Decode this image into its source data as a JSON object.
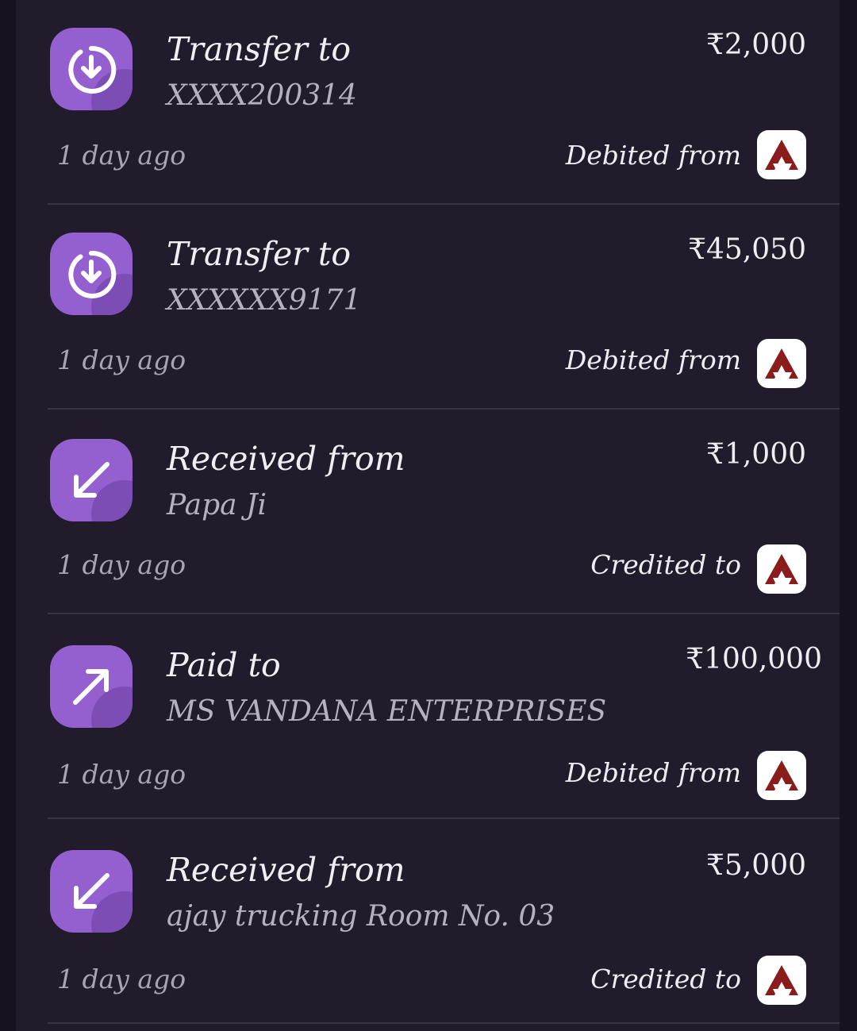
{
  "colors": {
    "background": "#17121f",
    "panel": "#221b2c",
    "icon_accent": "#9460cf",
    "bank_logo": "#8a1c1c"
  },
  "transactions": [
    {
      "type_label": "Transfer to",
      "party": "XXXX200314",
      "amount": "₹2,000",
      "time": "1 day ago",
      "direction_label": "Debited from",
      "icon": "transfer-icon",
      "bank_icon": "bank-logo-icon"
    },
    {
      "type_label": "Transfer to",
      "party": "XXXXXX9171",
      "amount": "₹45,050",
      "time": "1 day ago",
      "direction_label": "Debited from",
      "icon": "transfer-icon",
      "bank_icon": "bank-logo-icon"
    },
    {
      "type_label": "Received from",
      "party": "Papa Ji",
      "amount": "₹1,000",
      "time": "1 day ago",
      "direction_label": "Credited to",
      "icon": "received-arrow-icon",
      "bank_icon": "bank-logo-icon"
    },
    {
      "type_label": "Paid to",
      "party": "MS VANDANA ENTERPRISES",
      "amount": "₹100,000",
      "time": "1 day ago",
      "direction_label": "Debited from",
      "icon": "paid-arrow-icon",
      "bank_icon": "bank-logo-icon"
    },
    {
      "type_label": "Received from",
      "party": "ajay trucking Room No. 03",
      "amount": "₹5,000",
      "time": "1 day ago",
      "direction_label": "Credited to",
      "icon": "received-arrow-icon",
      "bank_icon": "bank-logo-icon"
    }
  ]
}
